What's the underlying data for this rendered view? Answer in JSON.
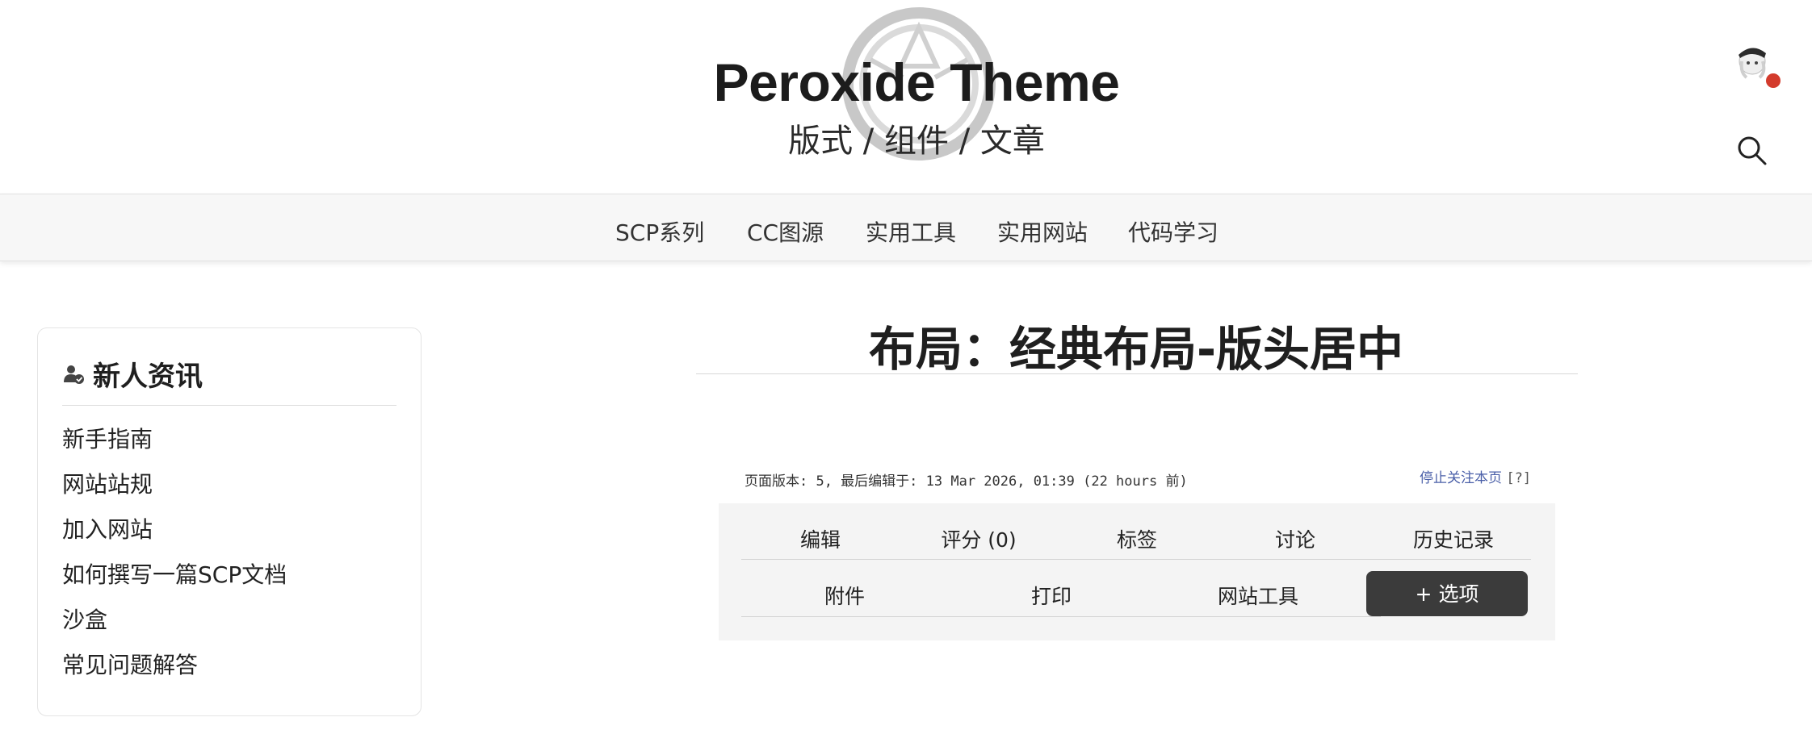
{
  "header": {
    "title": "Peroxide Theme",
    "subtitle": "版式 / 组件 / 文章"
  },
  "nav": {
    "items": [
      {
        "label": "SCP系列"
      },
      {
        "label": "CC图源"
      },
      {
        "label": "实用工具"
      },
      {
        "label": "实用网站"
      },
      {
        "label": "代码学习"
      }
    ]
  },
  "sidebar": {
    "heading": "新人资讯",
    "heading_icon": "user-check-icon",
    "items": [
      {
        "label": "新手指南"
      },
      {
        "label": "网站站规"
      },
      {
        "label": "加入网站"
      },
      {
        "label": "如何撰写一篇SCP文档"
      },
      {
        "label": "沙盒"
      },
      {
        "label": "常见问题解答"
      }
    ]
  },
  "main": {
    "title": "布局：经典布局-版头居中",
    "page_info": "页面版本: 5, 最后编辑于: 13 Mar 2026, 01:39 (22 hours 前)",
    "watch_label": "停止关注本页",
    "help_label": "[?]",
    "options_row1": [
      {
        "label": "编辑"
      },
      {
        "label": "评分 (0)"
      },
      {
        "label": "标签"
      },
      {
        "label": "讨论"
      },
      {
        "label": "历史记录"
      }
    ],
    "options_row2": [
      {
        "label": "附件"
      },
      {
        "label": "打印"
      },
      {
        "label": "网站工具"
      }
    ],
    "options_button": "+ 选项"
  },
  "colors": {
    "accent_dark": "#3b3b3b",
    "notification_dot": "#d33b2c",
    "link": "#4a5fa8"
  },
  "icons": {
    "search": "search-icon",
    "avatar": "avatar",
    "logo": "logo-ring-icon"
  }
}
